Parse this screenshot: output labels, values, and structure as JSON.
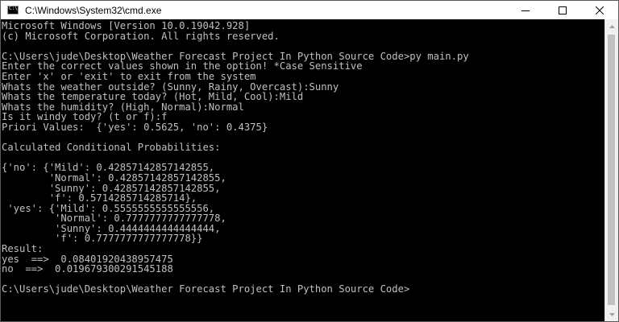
{
  "window": {
    "title": "C:\\Windows\\System32\\cmd.exe",
    "icon": "cmd-icon",
    "colors": {
      "console_bg": "#000000",
      "console_text": "#c0c0c0",
      "titlebar_bg": "#ffffff"
    }
  },
  "controls": {
    "minimize": "minimize-icon",
    "maximize": "maximize-icon",
    "close": "close-icon"
  },
  "console": {
    "lines": [
      "Microsoft Windows [Version 10.0.19042.928]",
      "(c) Microsoft Corporation. All rights reserved.",
      "",
      "C:\\Users\\jude\\Desktop\\Weather Forecast Project In Python Source Code>py main.py",
      "Enter the correct values shown in the option! *Case Sensitive",
      "Enter 'x' or 'exit' to exit from the system",
      "Whats the weather outside? (Sunny, Rainy, Overcast):Sunny",
      "Whats the temperature today? (Hot, Mild, Cool):Mild",
      "Whats the humidity? (High, Normal):Normal",
      "Is it windy tody? (t or f):f",
      "Priori Values:  {'yes': 0.5625, 'no': 0.4375}",
      "",
      "Calculated Conditional Probabilities:",
      "",
      "{'no': {'Mild': 0.42857142857142855,",
      "        'Normal': 0.42857142857142855,",
      "        'Sunny': 0.42857142857142855,",
      "        'f': 0.5714285714285714},",
      " 'yes': {'Mild': 0.5555555555555556,",
      "         'Normal': 0.7777777777777778,",
      "         'Sunny': 0.4444444444444444,",
      "         'f': 0.7777777777777778}}",
      "Result:",
      "yes  ==>  0.08401920438957475",
      "no  ==>  0.019679300291545188",
      "",
      "C:\\Users\\jude\\Desktop\\Weather Forecast Project In Python Source Code>"
    ]
  }
}
